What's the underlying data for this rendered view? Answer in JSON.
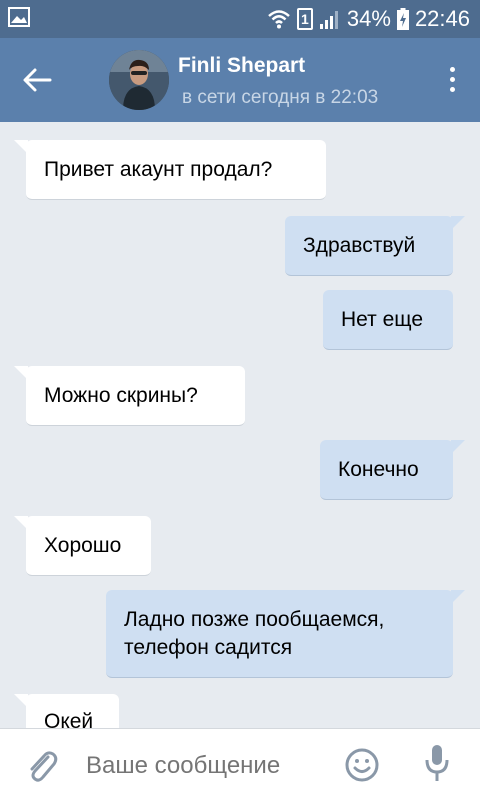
{
  "status_bar": {
    "battery_percent": "34%",
    "sim_slot": "1",
    "time": "22:46"
  },
  "header": {
    "contact_name": "Finli Shepart",
    "contact_status": "в сети сегодня в 22:03"
  },
  "messages": [
    {
      "direction": "in",
      "text": "Привет акаунт продал?"
    },
    {
      "direction": "out",
      "text": "Здравствуй"
    },
    {
      "direction": "out",
      "text": "Нет еще"
    },
    {
      "direction": "in",
      "text": "Можно скрины?"
    },
    {
      "direction": "out",
      "text": "Конечно"
    },
    {
      "direction": "in",
      "text": "Хорошо"
    },
    {
      "direction": "out",
      "lines": [
        "Ладно позже пообщаемся,",
        "телефон садится"
      ]
    },
    {
      "direction": "in",
      "text": "Окей"
    }
  ],
  "composer": {
    "placeholder": "Ваше сообщение"
  },
  "icons": {
    "back": "arrow-left-icon",
    "menu": "more-vertical-icon",
    "attach": "paperclip-icon",
    "emoji": "smiley-icon",
    "mic": "microphone-icon"
  },
  "colors": {
    "status_bar": "#4e6c8f",
    "header": "#5b80ac",
    "background": "#e7ebf0",
    "incoming_bubble": "#ffffff",
    "outgoing_bubble": "#cfdff2"
  }
}
